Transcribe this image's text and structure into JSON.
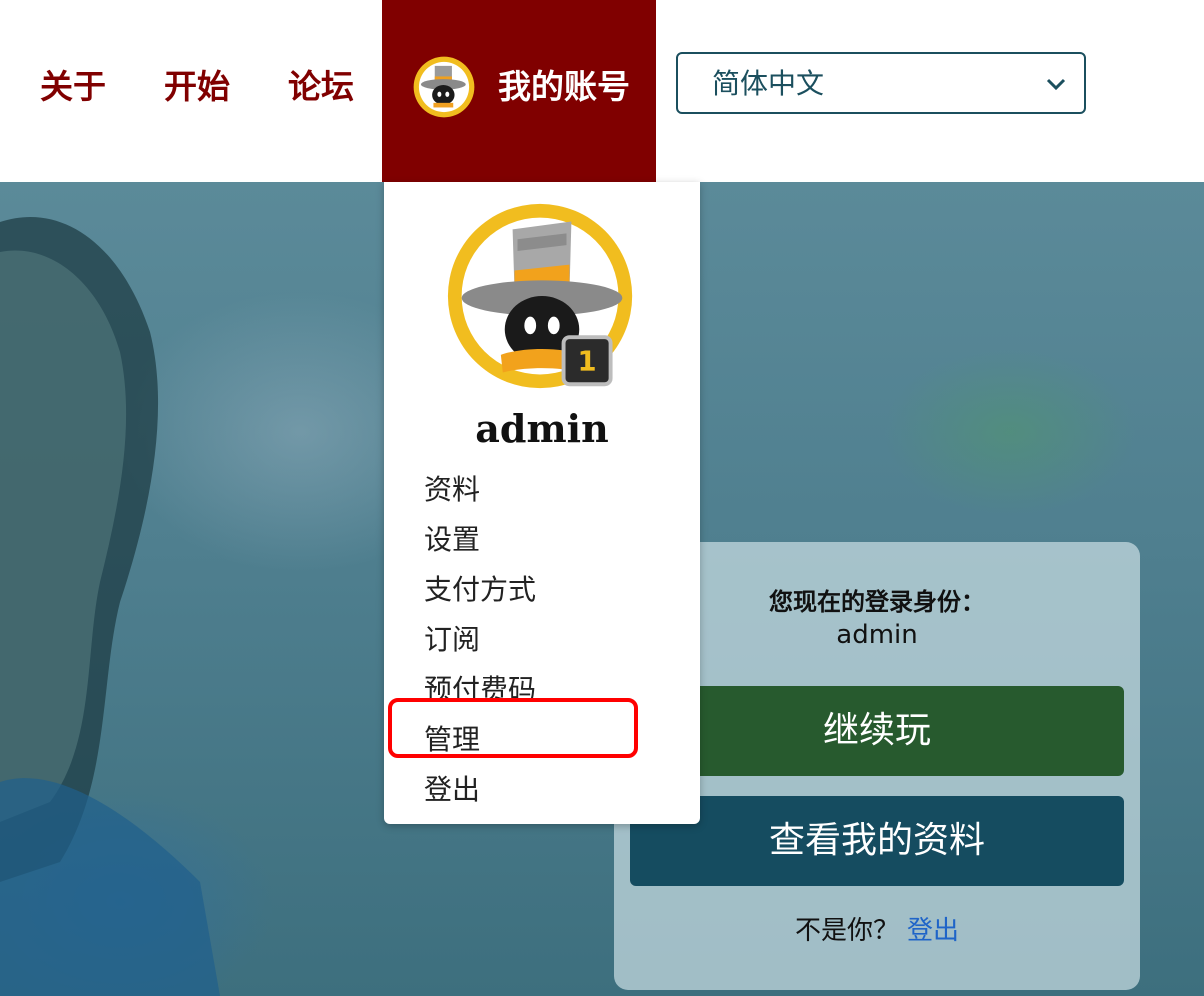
{
  "nav": {
    "links": [
      "关于",
      "开始",
      "论坛"
    ],
    "account_label": "我的账号",
    "language": {
      "selected": "简体中文"
    }
  },
  "dropdown": {
    "username": "admin",
    "level_badge": "1",
    "items": [
      "资料",
      "设置",
      "支付方式",
      "订阅",
      "预付费码",
      "管理",
      "登出"
    ]
  },
  "login_card": {
    "title": "您现在的登录身份：",
    "username": "admin",
    "continue_button": "继续玩",
    "profile_button": "查看我的资料",
    "not_you_text": "不是你？",
    "logout_link": "登出"
  },
  "colors": {
    "brand": "#800000",
    "continue": "#275a2e",
    "profile": "#154c60",
    "link": "#1f64c8",
    "highlight": "#ff0000"
  },
  "icons": {
    "avatar": "wizard-hat-avatar-icon",
    "select_chevron": "chevron-down-icon"
  }
}
